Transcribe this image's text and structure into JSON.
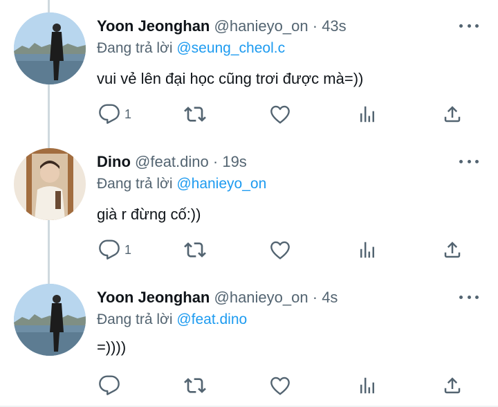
{
  "reply_prefix": "Đang trả lời",
  "tweets": [
    {
      "name": "Yoon Jeonghan",
      "handle": "@hanieyo_on",
      "dot": "·",
      "time": "43s",
      "reply_to": "@seung_cheol.c",
      "text": "vui vẻ lên đại học cũng trơi được mà=))",
      "reply_count": "1"
    },
    {
      "name": "Dino",
      "handle": "@feat.dino",
      "dot": "·",
      "time": "19s",
      "reply_to": "@hanieyo_on",
      "text": "già r đừng cố:))",
      "reply_count": "1"
    },
    {
      "name": "Yoon Jeonghan",
      "handle": "@hanieyo_on",
      "dot": "·",
      "time": "4s",
      "reply_to": "@feat.dino",
      "text": "=))))",
      "reply_count": ""
    }
  ],
  "icons": {
    "reply": "reply-icon",
    "retweet": "retweet-icon",
    "like": "heart-icon",
    "views": "analytics-icon",
    "share": "share-icon",
    "more": "more-icon"
  },
  "colors": {
    "accent": "#1d9bf0",
    "secondary_text": "#536471",
    "thread_line": "#cfd9de"
  }
}
